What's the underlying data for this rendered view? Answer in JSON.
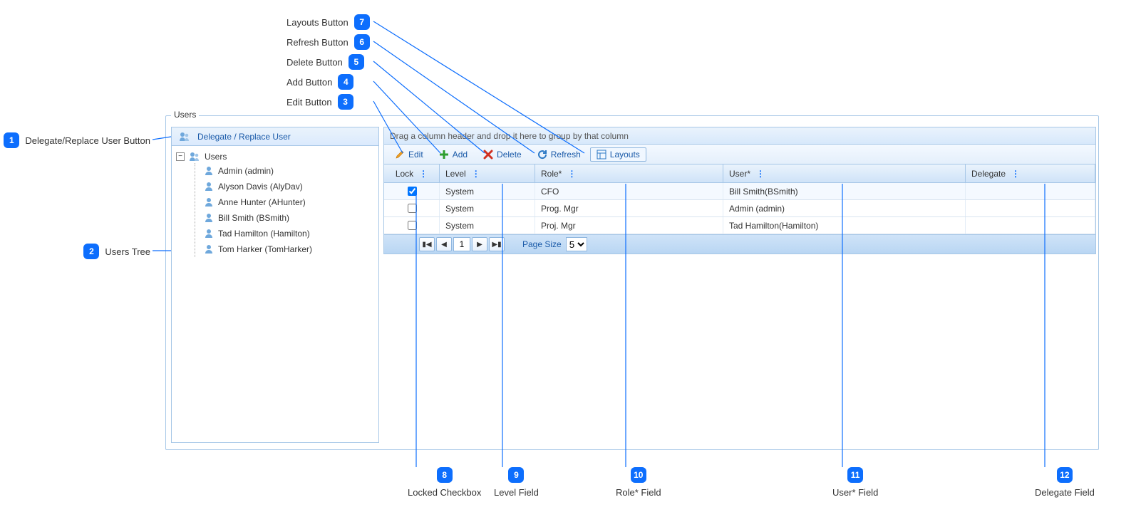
{
  "panel": {
    "legend": "Users"
  },
  "sidebar": {
    "delegate_label": "Delegate / Replace User",
    "root_label": "Users",
    "items": [
      {
        "label": "Admin (admin)"
      },
      {
        "label": "Alyson Davis (AlyDav)"
      },
      {
        "label": "Anne Hunter (AHunter)"
      },
      {
        "label": "Bill Smith (BSmith)"
      },
      {
        "label": "Tad Hamilton (Hamilton)"
      },
      {
        "label": "Tom Harker (TomHarker)"
      }
    ]
  },
  "toolbar": {
    "edit": "Edit",
    "add": "Add",
    "delete": "Delete",
    "refresh": "Refresh",
    "layouts": "Layouts"
  },
  "grid": {
    "group_hint": "Drag a column header and drop it here to group by that column",
    "columns": {
      "lock": "Lock",
      "level": "Level",
      "role": "Role*",
      "user": "User*",
      "delegate": "Delegate"
    },
    "rows": [
      {
        "locked": true,
        "level": "System",
        "role": "CFO",
        "user": "Bill Smith(BSmith)",
        "delegate": ""
      },
      {
        "locked": false,
        "level": "System",
        "role": "Prog. Mgr",
        "user": "Admin (admin)",
        "delegate": ""
      },
      {
        "locked": false,
        "level": "System",
        "role": "Proj. Mgr",
        "user": "Tad Hamilton(Hamilton)",
        "delegate": ""
      }
    ],
    "pager": {
      "page": "1",
      "page_size_label": "Page Size",
      "page_size": "5"
    }
  },
  "callouts": {
    "c1": "Delegate/Replace User Button",
    "c2": "Users Tree",
    "c3": "Edit Button",
    "c4": "Add Button",
    "c5": "Delete Button",
    "c6": "Refresh Button",
    "c7": "Layouts Button",
    "c8": "Locked Checkbox",
    "c9": "Level Field",
    "c10": "Role* Field",
    "c11": "User* Field",
    "c12": "Delegate Field",
    "n1": "1",
    "n2": "2",
    "n3": "3",
    "n4": "4",
    "n5": "5",
    "n6": "6",
    "n7": "7",
    "n8": "8",
    "n9": "9",
    "n10": "10",
    "n11": "11",
    "n12": "12"
  }
}
